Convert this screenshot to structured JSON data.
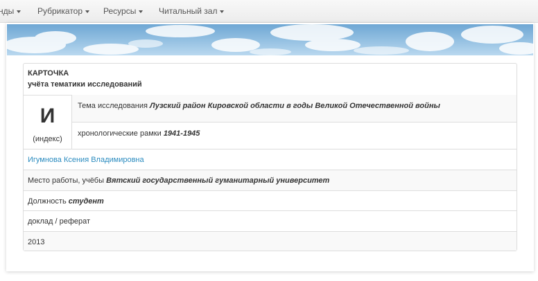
{
  "navbar": {
    "items": [
      {
        "label": "нды"
      },
      {
        "label": "Рубрикатор"
      },
      {
        "label": "Ресурсы"
      },
      {
        "label": "Читальный зал"
      }
    ]
  },
  "card": {
    "title": "КАРТОЧКА",
    "subtitle": "учёта тематики исследований",
    "index_letter": "И",
    "index_label": "(индекс)",
    "topic": {
      "label": "Тема исследования",
      "value": "Лузский район Кировской области в годы Великой Отечественной войны"
    },
    "chronology": {
      "label": "хронологические рамки",
      "value": "1941-1945"
    },
    "author": "Игумнова Ксения Владимировна",
    "workplace": {
      "label": "Место работы, учёбы",
      "value": "Вятский государственный гуманитарный университет"
    },
    "position": {
      "label": "Должность",
      "value": "студент"
    },
    "work_type": "доклад / реферат",
    "year": "2013"
  },
  "colors": {
    "link": "#2a8bbf",
    "border": "#dddddd",
    "stripe": "#f9f9f9"
  }
}
